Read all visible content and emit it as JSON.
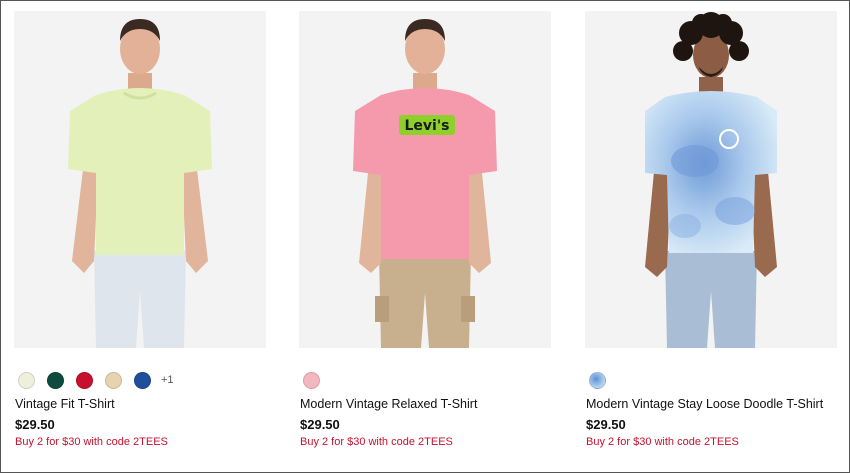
{
  "products": [
    {
      "name": "Vintage Fit T-Shirt",
      "price": "$29.50",
      "promo": "Buy 2 for $30 with code 2TEES",
      "swatches": [
        "#eef0dc",
        "#0f4a3e",
        "#c8102e",
        "#e6d3b0",
        "#1f4e9a"
      ],
      "more_colors": "+1",
      "image": "model-light-green-tee"
    },
    {
      "name": "Modern Vintage Relaxed T-Shirt",
      "price": "$29.50",
      "promo": "Buy 2 for $30 with code 2TEES",
      "swatches": [
        "#f5b7bf"
      ],
      "more_colors": "",
      "image": "model-pink-logo-tee"
    },
    {
      "name": "Modern Vintage Stay Loose Doodle T-Shirt",
      "price": "$29.50",
      "promo": "Buy 2 for $30 with code 2TEES",
      "swatches": [
        "#8ab4de"
      ],
      "more_colors": "",
      "image": "model-tie-dye-tee"
    }
  ],
  "logo_text": "Levi's",
  "colors": {
    "promo": "#c41230",
    "photo_bg": "#f2f2f2"
  }
}
